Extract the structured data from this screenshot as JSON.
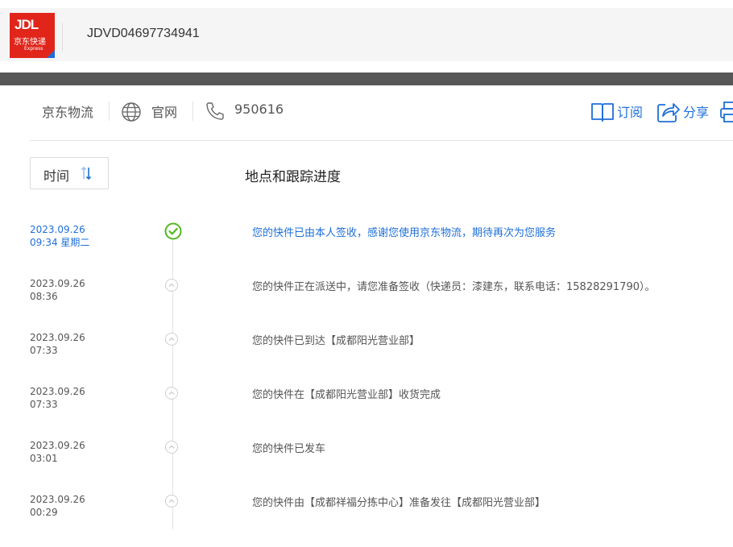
{
  "header": {
    "logo": {
      "brand": "JDL",
      "cn": "京东快递",
      "en": "Express"
    },
    "tracking_number": "JDVD04697734941"
  },
  "carrier": {
    "name": "京东物流",
    "website_label": "官网",
    "phone": "950616"
  },
  "actions": {
    "subscribe_label": "订阅",
    "share_label": "分享"
  },
  "colors": {
    "accent": "#1e6fd9",
    "brand_red": "#e1251b",
    "success_green": "#52b81e"
  },
  "table": {
    "sort_label": "时间",
    "column_title": "地点和跟踪进度"
  },
  "events": [
    {
      "date": "2023.09.26",
      "time": "09:34 星期二",
      "text": "您的快件已由本人签收，感谢您使用京东物流，期待再次为您服务"
    },
    {
      "date": "2023.09.26",
      "time": "08:36",
      "text": "您的快件正在派送中，请您准备签收（快递员：漆建东，联系电话：15828291790）。"
    },
    {
      "date": "2023.09.26",
      "time": "07:33",
      "text": "您的快件已到达【成都阳光营业部】"
    },
    {
      "date": "2023.09.26",
      "time": "07:33",
      "text": "您的快件在【成都阳光营业部】收货完成"
    },
    {
      "date": "2023.09.26",
      "time": "03:01",
      "text": "您的快件已发车"
    },
    {
      "date": "2023.09.26",
      "time": "00:29",
      "text": "您的快件由【成都祥福分拣中心】准备发往【成都阳光营业部】"
    }
  ]
}
